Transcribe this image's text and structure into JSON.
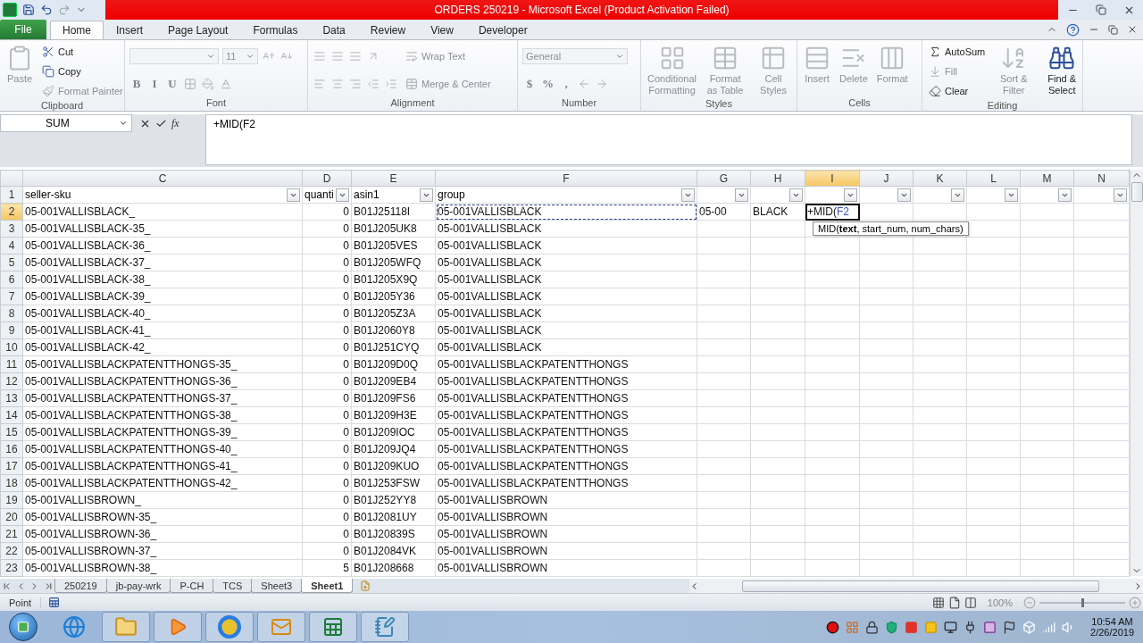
{
  "window": {
    "title": "ORDERS 250219 - Microsoft Excel (Product Activation Failed)"
  },
  "ribbon_tabs": [
    {
      "label": "File",
      "kind": "file",
      "selected": false
    },
    {
      "label": "Home",
      "kind": "tab",
      "selected": true
    },
    {
      "label": "Insert",
      "kind": "tab",
      "selected": false
    },
    {
      "label": "Page Layout",
      "kind": "tab",
      "selected": false
    },
    {
      "label": "Formulas",
      "kind": "tab",
      "selected": false
    },
    {
      "label": "Data",
      "kind": "tab",
      "selected": false
    },
    {
      "label": "Review",
      "kind": "tab",
      "selected": false
    },
    {
      "label": "View",
      "kind": "tab",
      "selected": false
    },
    {
      "label": "Developer",
      "kind": "tab",
      "selected": false
    }
  ],
  "ribbon_groups": [
    {
      "label": "Clipboard",
      "sections": [
        {
          "kind": "large",
          "label": "Paste",
          "disabled": true
        },
        {
          "kind": "stack",
          "rows": [
            [
              {
                "kind": "small",
                "label": "Cut",
                "disabled": false
              }
            ],
            [
              {
                "kind": "small",
                "label": "Copy",
                "disabled": false
              }
            ],
            [
              {
                "kind": "small",
                "label": "Format Painter",
                "disabled": true
              }
            ]
          ]
        }
      ]
    },
    {
      "label": "Font",
      "sections": [
        {
          "kind": "stack",
          "rows": [
            [
              {
                "kind": "combo",
                "disabled": true
              },
              {
                "kind": "combo",
                "value": "11",
                "disabled": true
              },
              {
                "kind": "icon",
                "disabled": true
              },
              {
                "kind": "icon",
                "disabled": true
              }
            ],
            [
              {
                "kind": "glyph",
                "label": "B",
                "disabled": true
              },
              {
                "kind": "glyph",
                "label": "I",
                "disabled": true
              },
              {
                "kind": "glyph",
                "label": "U",
                "disabled": true
              },
              {
                "kind": "icon",
                "disabled": true
              },
              {
                "kind": "icon",
                "disabled": true
              },
              {
                "kind": "icon",
                "disabled": true
              }
            ]
          ]
        }
      ]
    },
    {
      "label": "Alignment",
      "sections": [
        {
          "kind": "stack",
          "rows": [
            [
              {
                "kind": "icon",
                "disabled": true
              },
              {
                "kind": "icon",
                "disabled": true
              },
              {
                "kind": "icon",
                "disabled": true
              },
              {
                "kind": "icon",
                "disabled": true
              }
            ],
            [
              {
                "kind": "icon",
                "disabled": true
              },
              {
                "kind": "icon",
                "disabled": true
              },
              {
                "kind": "icon",
                "disabled": true
              },
              {
                "kind": "icon",
                "disabled": true
              },
              {
                "kind": "icon",
                "disabled": true
              }
            ]
          ]
        },
        {
          "kind": "stack",
          "rows": [
            [
              {
                "kind": "small",
                "label": "Wrap Text",
                "disabled": true
              }
            ],
            [
              {
                "kind": "small",
                "label": "Merge & Center",
                "disabled": true
              }
            ]
          ]
        }
      ]
    },
    {
      "label": "Number",
      "sections": [
        {
          "kind": "stack",
          "rows": [
            [
              {
                "kind": "combo",
                "value": "General",
                "disabled": true
              }
            ],
            [
              {
                "kind": "glyph",
                "label": "$",
                "disabled": true
              },
              {
                "kind": "glyph",
                "label": "%",
                "disabled": true
              },
              {
                "kind": "glyph",
                "label": ",",
                "disabled": true
              },
              {
                "kind": "icon",
                "disabled": true
              },
              {
                "kind": "icon",
                "disabled": true
              }
            ]
          ]
        }
      ]
    },
    {
      "label": "Styles",
      "sections": [
        {
          "kind": "large",
          "label": "Conditional Formatting",
          "disabled": true
        },
        {
          "kind": "large",
          "label": "Format as Table",
          "disabled": true
        },
        {
          "kind": "large",
          "label": "Cell Styles",
          "disabled": true
        }
      ]
    },
    {
      "label": "Cells",
      "sections": [
        {
          "kind": "large",
          "label": "Insert",
          "disabled": true
        },
        {
          "kind": "large",
          "label": "Delete",
          "disabled": true
        },
        {
          "kind": "large",
          "label": "Format",
          "disabled": true
        }
      ]
    },
    {
      "label": "Editing",
      "sections": [
        {
          "kind": "stack",
          "rows": [
            [
              {
                "kind": "small",
                "label": "AutoSum",
                "disabled": false
              }
            ],
            [
              {
                "kind": "small",
                "label": "Fill",
                "disabled": true
              }
            ],
            [
              {
                "kind": "small",
                "label": "Clear",
                "disabled": false
              }
            ]
          ]
        },
        {
          "kind": "large",
          "label": "Sort & Filter",
          "disabled": true
        },
        {
          "kind": "large",
          "label": "Find & Select",
          "disabled": false
        }
      ]
    }
  ],
  "formula_bar": {
    "name_box": "SUM",
    "function_button": "fx",
    "formula": "+MID(F2"
  },
  "columns": [
    {
      "letter": "C",
      "selected": false
    },
    {
      "letter": "D",
      "selected": false
    },
    {
      "letter": "E",
      "selected": false
    },
    {
      "letter": "F",
      "selected": false
    },
    {
      "letter": "G",
      "selected": false
    },
    {
      "letter": "H",
      "selected": false
    },
    {
      "letter": "I",
      "selected": true
    },
    {
      "letter": "J",
      "selected": false
    },
    {
      "letter": "K",
      "selected": false
    },
    {
      "letter": "L",
      "selected": false
    },
    {
      "letter": "M",
      "selected": false
    },
    {
      "letter": "N",
      "selected": false
    }
  ],
  "header_row": {
    "number": "1",
    "selected": false,
    "labels": [
      "seller-sku",
      "quanti",
      "asin1",
      "group"
    ]
  },
  "rows": [
    {
      "number": "2",
      "selected": true,
      "seller_sku": "05-001VALLISBLACK_",
      "quantity": "0",
      "asin1": "B01J25118I",
      "group": "05-001VALLISBLACK",
      "group_marked": true,
      "column_g": "05-00",
      "column_h": "BLACK",
      "column_i": {
        "text": "+MID(",
        "reference": "F2"
      }
    },
    {
      "number": "3",
      "selected": false,
      "seller_sku": "05-001VALLISBLACK-35_",
      "quantity": "0",
      "asin1": "B01J205UK8",
      "group": "05-001VALLISBLACK",
      "group_marked": false
    },
    {
      "number": "4",
      "selected": false,
      "seller_sku": "05-001VALLISBLACK-36_",
      "quantity": "0",
      "asin1": "B01J205VES",
      "group": "05-001VALLISBLACK",
      "group_marked": false
    },
    {
      "number": "5",
      "selected": false,
      "seller_sku": "05-001VALLISBLACK-37_",
      "quantity": "0",
      "asin1": "B01J205WFQ",
      "group": "05-001VALLISBLACK",
      "group_marked": false
    },
    {
      "number": "6",
      "selected": false,
      "seller_sku": "05-001VALLISBLACK-38_",
      "quantity": "0",
      "asin1": "B01J205X9Q",
      "group": "05-001VALLISBLACK",
      "group_marked": false
    },
    {
      "number": "7",
      "selected": false,
      "seller_sku": "05-001VALLISBLACK-39_",
      "quantity": "0",
      "asin1": "B01J205Y36",
      "group": "05-001VALLISBLACK",
      "group_marked": false
    },
    {
      "number": "8",
      "selected": false,
      "seller_sku": "05-001VALLISBLACK-40_",
      "quantity": "0",
      "asin1": "B01J205Z3A",
      "group": "05-001VALLISBLACK",
      "group_marked": false
    },
    {
      "number": "9",
      "selected": false,
      "seller_sku": "05-001VALLISBLACK-41_",
      "quantity": "0",
      "asin1": "B01J2060Y8",
      "group": "05-001VALLISBLACK",
      "group_marked": false
    },
    {
      "number": "10",
      "selected": false,
      "seller_sku": "05-001VALLISBLACK-42_",
      "quantity": "0",
      "asin1": "B01J251CYQ",
      "group": "05-001VALLISBLACK",
      "group_marked": false
    },
    {
      "number": "11",
      "selected": false,
      "seller_sku": "05-001VALLISBLACKPATENTTHONGS-35_",
      "quantity": "0",
      "asin1": "B01J209D0Q",
      "group": "05-001VALLISBLACKPATENTTHONGS",
      "group_marked": false
    },
    {
      "number": "12",
      "selected": false,
      "seller_sku": "05-001VALLISBLACKPATENTTHONGS-36_",
      "quantity": "0",
      "asin1": "B01J209EB4",
      "group": "05-001VALLISBLACKPATENTTHONGS",
      "group_marked": false
    },
    {
      "number": "13",
      "selected": false,
      "seller_sku": "05-001VALLISBLACKPATENTTHONGS-37_",
      "quantity": "0",
      "asin1": "B01J209FS6",
      "group": "05-001VALLISBLACKPATENTTHONGS",
      "group_marked": false
    },
    {
      "number": "14",
      "selected": false,
      "seller_sku": "05-001VALLISBLACKPATENTTHONGS-38_",
      "quantity": "0",
      "asin1": "B01J209H3E",
      "group": "05-001VALLISBLACKPATENTTHONGS",
      "group_marked": false
    },
    {
      "number": "15",
      "selected": false,
      "seller_sku": "05-001VALLISBLACKPATENTTHONGS-39_",
      "quantity": "0",
      "asin1": "B01J209IOC",
      "group": "05-001VALLISBLACKPATENTTHONGS",
      "group_marked": false
    },
    {
      "number": "16",
      "selected": false,
      "seller_sku": "05-001VALLISBLACKPATENTTHONGS-40_",
      "quantity": "0",
      "asin1": "B01J209JQ4",
      "group": "05-001VALLISBLACKPATENTTHONGS",
      "group_marked": false
    },
    {
      "number": "17",
      "selected": false,
      "seller_sku": "05-001VALLISBLACKPATENTTHONGS-41_",
      "quantity": "0",
      "asin1": "B01J209KUO",
      "group": "05-001VALLISBLACKPATENTTHONGS",
      "group_marked": false
    },
    {
      "number": "18",
      "selected": false,
      "seller_sku": "05-001VALLISBLACKPATENTTHONGS-42_",
      "quantity": "0",
      "asin1": "B01J253FSW",
      "group": "05-001VALLISBLACKPATENTTHONGS",
      "group_marked": false
    },
    {
      "number": "19",
      "selected": false,
      "seller_sku": "05-001VALLISBROWN_",
      "quantity": "0",
      "asin1": "B01J252YY8",
      "group": "05-001VALLISBROWN",
      "group_marked": false
    },
    {
      "number": "20",
      "selected": false,
      "seller_sku": "05-001VALLISBROWN-35_",
      "quantity": "0",
      "asin1": "B01J2081UY",
      "group": "05-001VALLISBROWN",
      "group_marked": false
    },
    {
      "number": "21",
      "selected": false,
      "seller_sku": "05-001VALLISBROWN-36_",
      "quantity": "0",
      "asin1": "B01J20839S",
      "group": "05-001VALLISBROWN",
      "group_marked": false
    },
    {
      "number": "22",
      "selected": false,
      "seller_sku": "05-001VALLISBROWN-37_",
      "quantity": "0",
      "asin1": "B01J2084VK",
      "group": "05-001VALLISBROWN",
      "group_marked": false
    },
    {
      "number": "23",
      "selected": false,
      "seller_sku": "05-001VALLISBROWN-38_",
      "quantity": "5",
      "asin1": "B01J208668",
      "group": "05-001VALLISBROWN",
      "group_marked": false
    }
  ],
  "tooltip": "MID(**text**, start_num, num_chars)",
  "sheet_tabs": [
    {
      "label": "250219",
      "selected": false
    },
    {
      "label": "jb-pay-wrk",
      "selected": false
    },
    {
      "label": "P-CH",
      "selected": false
    },
    {
      "label": "TCS",
      "selected": false
    },
    {
      "label": "Sheet3",
      "selected": false
    },
    {
      "label": "Sheet1",
      "selected": true
    }
  ],
  "status_bar": {
    "mode": "Point",
    "zoom": "100%",
    "zoom_slider": {
      "level": 0.5
    }
  },
  "clock": {
    "time": "10:54 AM",
    "date": "2/26/2019"
  }
}
